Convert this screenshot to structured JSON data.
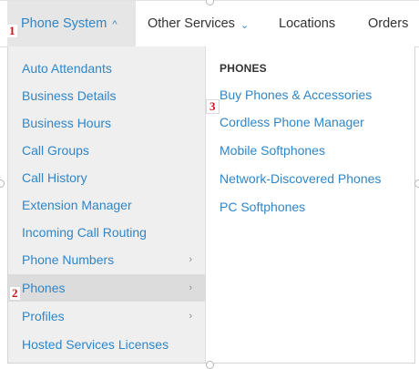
{
  "nav": {
    "tabs": [
      {
        "label": "Phone System",
        "active": true,
        "has_caret": true
      },
      {
        "label": "Other Services",
        "active": false,
        "has_caret": true
      },
      {
        "label": "Locations",
        "active": false,
        "has_caret": false
      },
      {
        "label": "Orders",
        "active": false,
        "has_caret": false
      }
    ],
    "caret_glyph": "^",
    "down_caret_glyph": "⌄"
  },
  "annotations": [
    "1",
    "2",
    "3"
  ],
  "menu": {
    "items": [
      {
        "label": "Auto Attendants",
        "has_submenu": false
      },
      {
        "label": "Business Details",
        "has_submenu": false
      },
      {
        "label": "Business Hours",
        "has_submenu": false
      },
      {
        "label": "Call Groups",
        "has_submenu": false
      },
      {
        "label": "Call History",
        "has_submenu": false
      },
      {
        "label": "Extension Manager",
        "has_submenu": false
      },
      {
        "label": "Incoming Call Routing",
        "has_submenu": false
      },
      {
        "label": "Phone Numbers",
        "has_submenu": true
      },
      {
        "label": "Phones",
        "has_submenu": true,
        "selected": true
      },
      {
        "label": "Profiles",
        "has_submenu": true
      },
      {
        "label": "Hosted Services Licenses",
        "has_submenu": false
      }
    ],
    "chevron_glyph": "›"
  },
  "submenu": {
    "heading": "PHONES",
    "items": [
      "Buy Phones & Accessories",
      "Cordless Phone Manager",
      "Mobile Softphones",
      "Network-Discovered Phones",
      "PC Softphones"
    ]
  },
  "colors": {
    "link": "#2f86c8",
    "annotation": "#d0111b",
    "menu_bg": "#efefef",
    "selected_bg": "#dcdcdc"
  }
}
